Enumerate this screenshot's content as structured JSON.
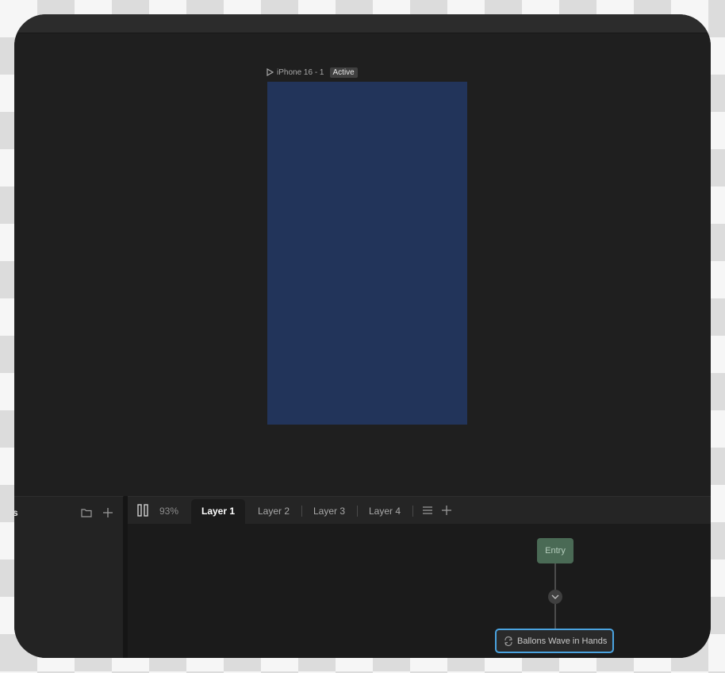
{
  "artboard": {
    "name": "iPhone 16 - 1",
    "status": "Active",
    "fill": "#22345a"
  },
  "left_panel": {
    "title_fragment": "s",
    "folder_icon": "folder-icon",
    "add_icon": "plus-icon"
  },
  "timeline": {
    "zoom": "93%",
    "tabs": [
      {
        "label": "Layer 1",
        "active": true
      },
      {
        "label": "Layer 2",
        "active": false
      },
      {
        "label": "Layer 3",
        "active": false
      },
      {
        "label": "Layer 4",
        "active": false
      }
    ],
    "menu_icon": "list-icon",
    "add_icon": "plus-icon"
  },
  "graph": {
    "entry_label": "Entry",
    "entry_color": "#4a6a55",
    "state_label": "Ballons Wave in Hands",
    "state_border_color": "#4aa3e0"
  }
}
